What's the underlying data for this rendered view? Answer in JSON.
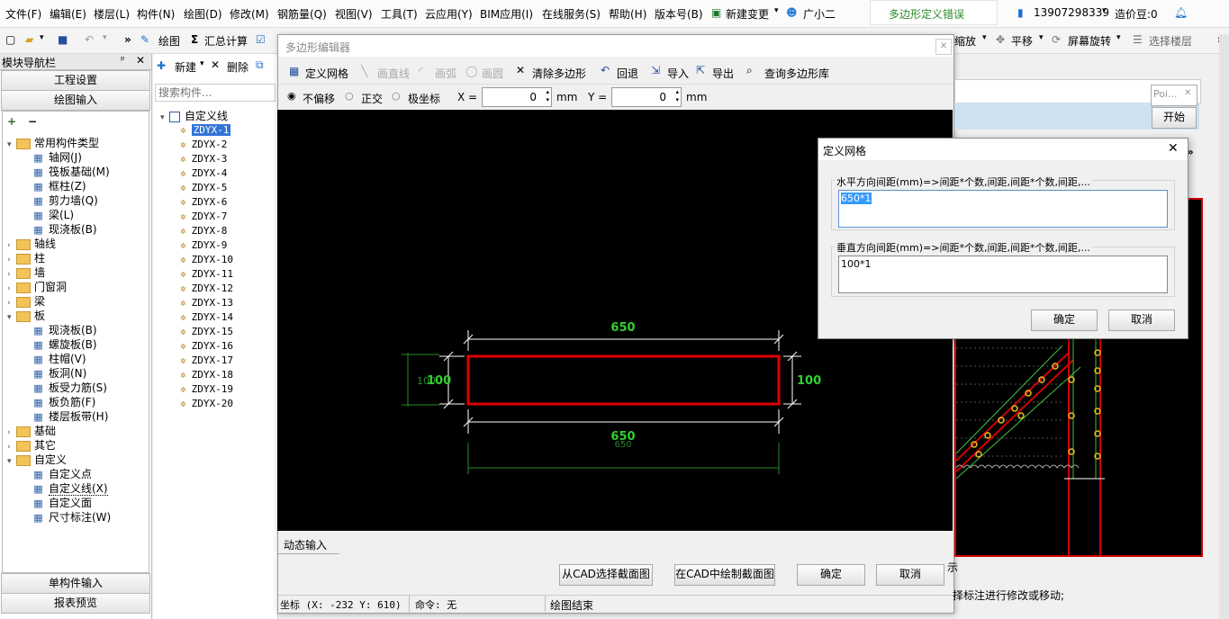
{
  "menu": [
    "文件(F)",
    "编辑(E)",
    "楼层(L)",
    "构件(N)",
    "绘图(D)",
    "修改(M)",
    "钢筋量(Q)",
    "视图(V)",
    "工具(T)",
    "云应用(Y)",
    "BIM应用(I)",
    "在线服务(S)",
    "帮助(H)",
    "版本号(B)",
    "新建变更",
    "广小二"
  ],
  "notice": "多边形定义错误",
  "account": {
    "phone": "13907298339",
    "beans": "造价豆:0"
  },
  "toolbar": {
    "draw": "绘图",
    "sum": "汇总计算",
    "zoom": "缩放",
    "pan": "平移",
    "rotate": "屏幕旋转",
    "floor": "选择楼层"
  },
  "nav": {
    "title": "模块导航栏",
    "pin": "ᵖ",
    "project_settings": "工程设置",
    "drawing_input": "绘图输入",
    "single_input": "单构件输入",
    "report": "报表预览",
    "tree": [
      {
        "label": "常用构件类型",
        "type": "folder",
        "expanded": true,
        "level": 0
      },
      {
        "label": "轴网(J)",
        "level": 1
      },
      {
        "label": "筏板基础(M)",
        "level": 1
      },
      {
        "label": "框柱(Z)",
        "level": 1
      },
      {
        "label": "剪力墙(Q)",
        "level": 1
      },
      {
        "label": "梁(L)",
        "level": 1
      },
      {
        "label": "现浇板(B)",
        "level": 1
      },
      {
        "label": "轴线",
        "type": "folder",
        "level": 0
      },
      {
        "label": "柱",
        "type": "folder",
        "level": 0
      },
      {
        "label": "墙",
        "type": "folder",
        "level": 0
      },
      {
        "label": "门窗洞",
        "type": "folder",
        "level": 0
      },
      {
        "label": "梁",
        "type": "folder",
        "level": 0
      },
      {
        "label": "板",
        "type": "folder",
        "expanded": true,
        "level": 0
      },
      {
        "label": "现浇板(B)",
        "level": 1
      },
      {
        "label": "螺旋板(B)",
        "level": 1
      },
      {
        "label": "柱帽(V)",
        "level": 1
      },
      {
        "label": "板洞(N)",
        "level": 1
      },
      {
        "label": "板受力筋(S)",
        "level": 1
      },
      {
        "label": "板负筋(F)",
        "level": 1
      },
      {
        "label": "楼层板带(H)",
        "level": 1
      },
      {
        "label": "基础",
        "type": "folder",
        "level": 0
      },
      {
        "label": "其它",
        "type": "folder",
        "level": 0
      },
      {
        "label": "自定义",
        "type": "folder",
        "expanded": true,
        "level": 0
      },
      {
        "label": "自定义点",
        "level": 1
      },
      {
        "label": "自定义线(X)",
        "level": 1,
        "selected": true
      },
      {
        "label": "自定义面",
        "level": 1
      },
      {
        "label": "尺寸标注(W)",
        "level": 1
      }
    ]
  },
  "components": {
    "new": "新建",
    "delete": "删除",
    "search_placeholder": "搜索构件...",
    "root": "自定义线",
    "items": [
      "ZDYX-1",
      "ZDYX-2",
      "ZDYX-3",
      "ZDYX-4",
      "ZDYX-5",
      "ZDYX-6",
      "ZDYX-7",
      "ZDYX-8",
      "ZDYX-9",
      "ZDYX-10",
      "ZDYX-11",
      "ZDYX-12",
      "ZDYX-13",
      "ZDYX-14",
      "ZDYX-15",
      "ZDYX-16",
      "ZDYX-17",
      "ZDYX-18",
      "ZDYX-19",
      "ZDYX-20"
    ]
  },
  "editor": {
    "title": "多边形编辑器",
    "tools": {
      "grid": "定义网格",
      "line": "画直线",
      "arc": "画弧",
      "circle": "画圆",
      "clear": "清除多边形",
      "undo": "回退",
      "import": "导入",
      "export": "导出",
      "query": "查询多边形库"
    },
    "mode": {
      "none": "不偏移",
      "ortho": "正交",
      "polar": "极坐标"
    },
    "x_label": "X =",
    "x_value": "0",
    "y_label": "Y =",
    "y_value": "0",
    "unit": "mm",
    "dims": {
      "top": "650",
      "bottom": "650",
      "bottom_small": "650",
      "left": "100",
      "left_small": "100",
      "right": "100"
    },
    "dynamic_input": "动态输入",
    "btn_from_cad": "从CAD选择截面图",
    "btn_draw_cad": "在CAD中绘制截面图",
    "ok": "确定",
    "cancel": "取消",
    "status_coord": "坐标 (X: -232 Y: 610)",
    "status_cmd": "命令: 无",
    "status_msg": "绘图结束"
  },
  "grid_dialog": {
    "title": "定义网格",
    "h_label": "水平方向间距(mm)=>间距*个数,间距,间距*个数,间距,...",
    "h_value": "650*1",
    "v_label": "垂直方向间距(mm)=>间距*个数,间距,间距*个数,间距,...",
    "v_value": "100*1",
    "ok": "确定",
    "cancel": "取消"
  },
  "right": {
    "popup_text": "Poi...",
    "start": "开始",
    "hint": "择标注进行修改或移动;",
    "frag": "示"
  }
}
